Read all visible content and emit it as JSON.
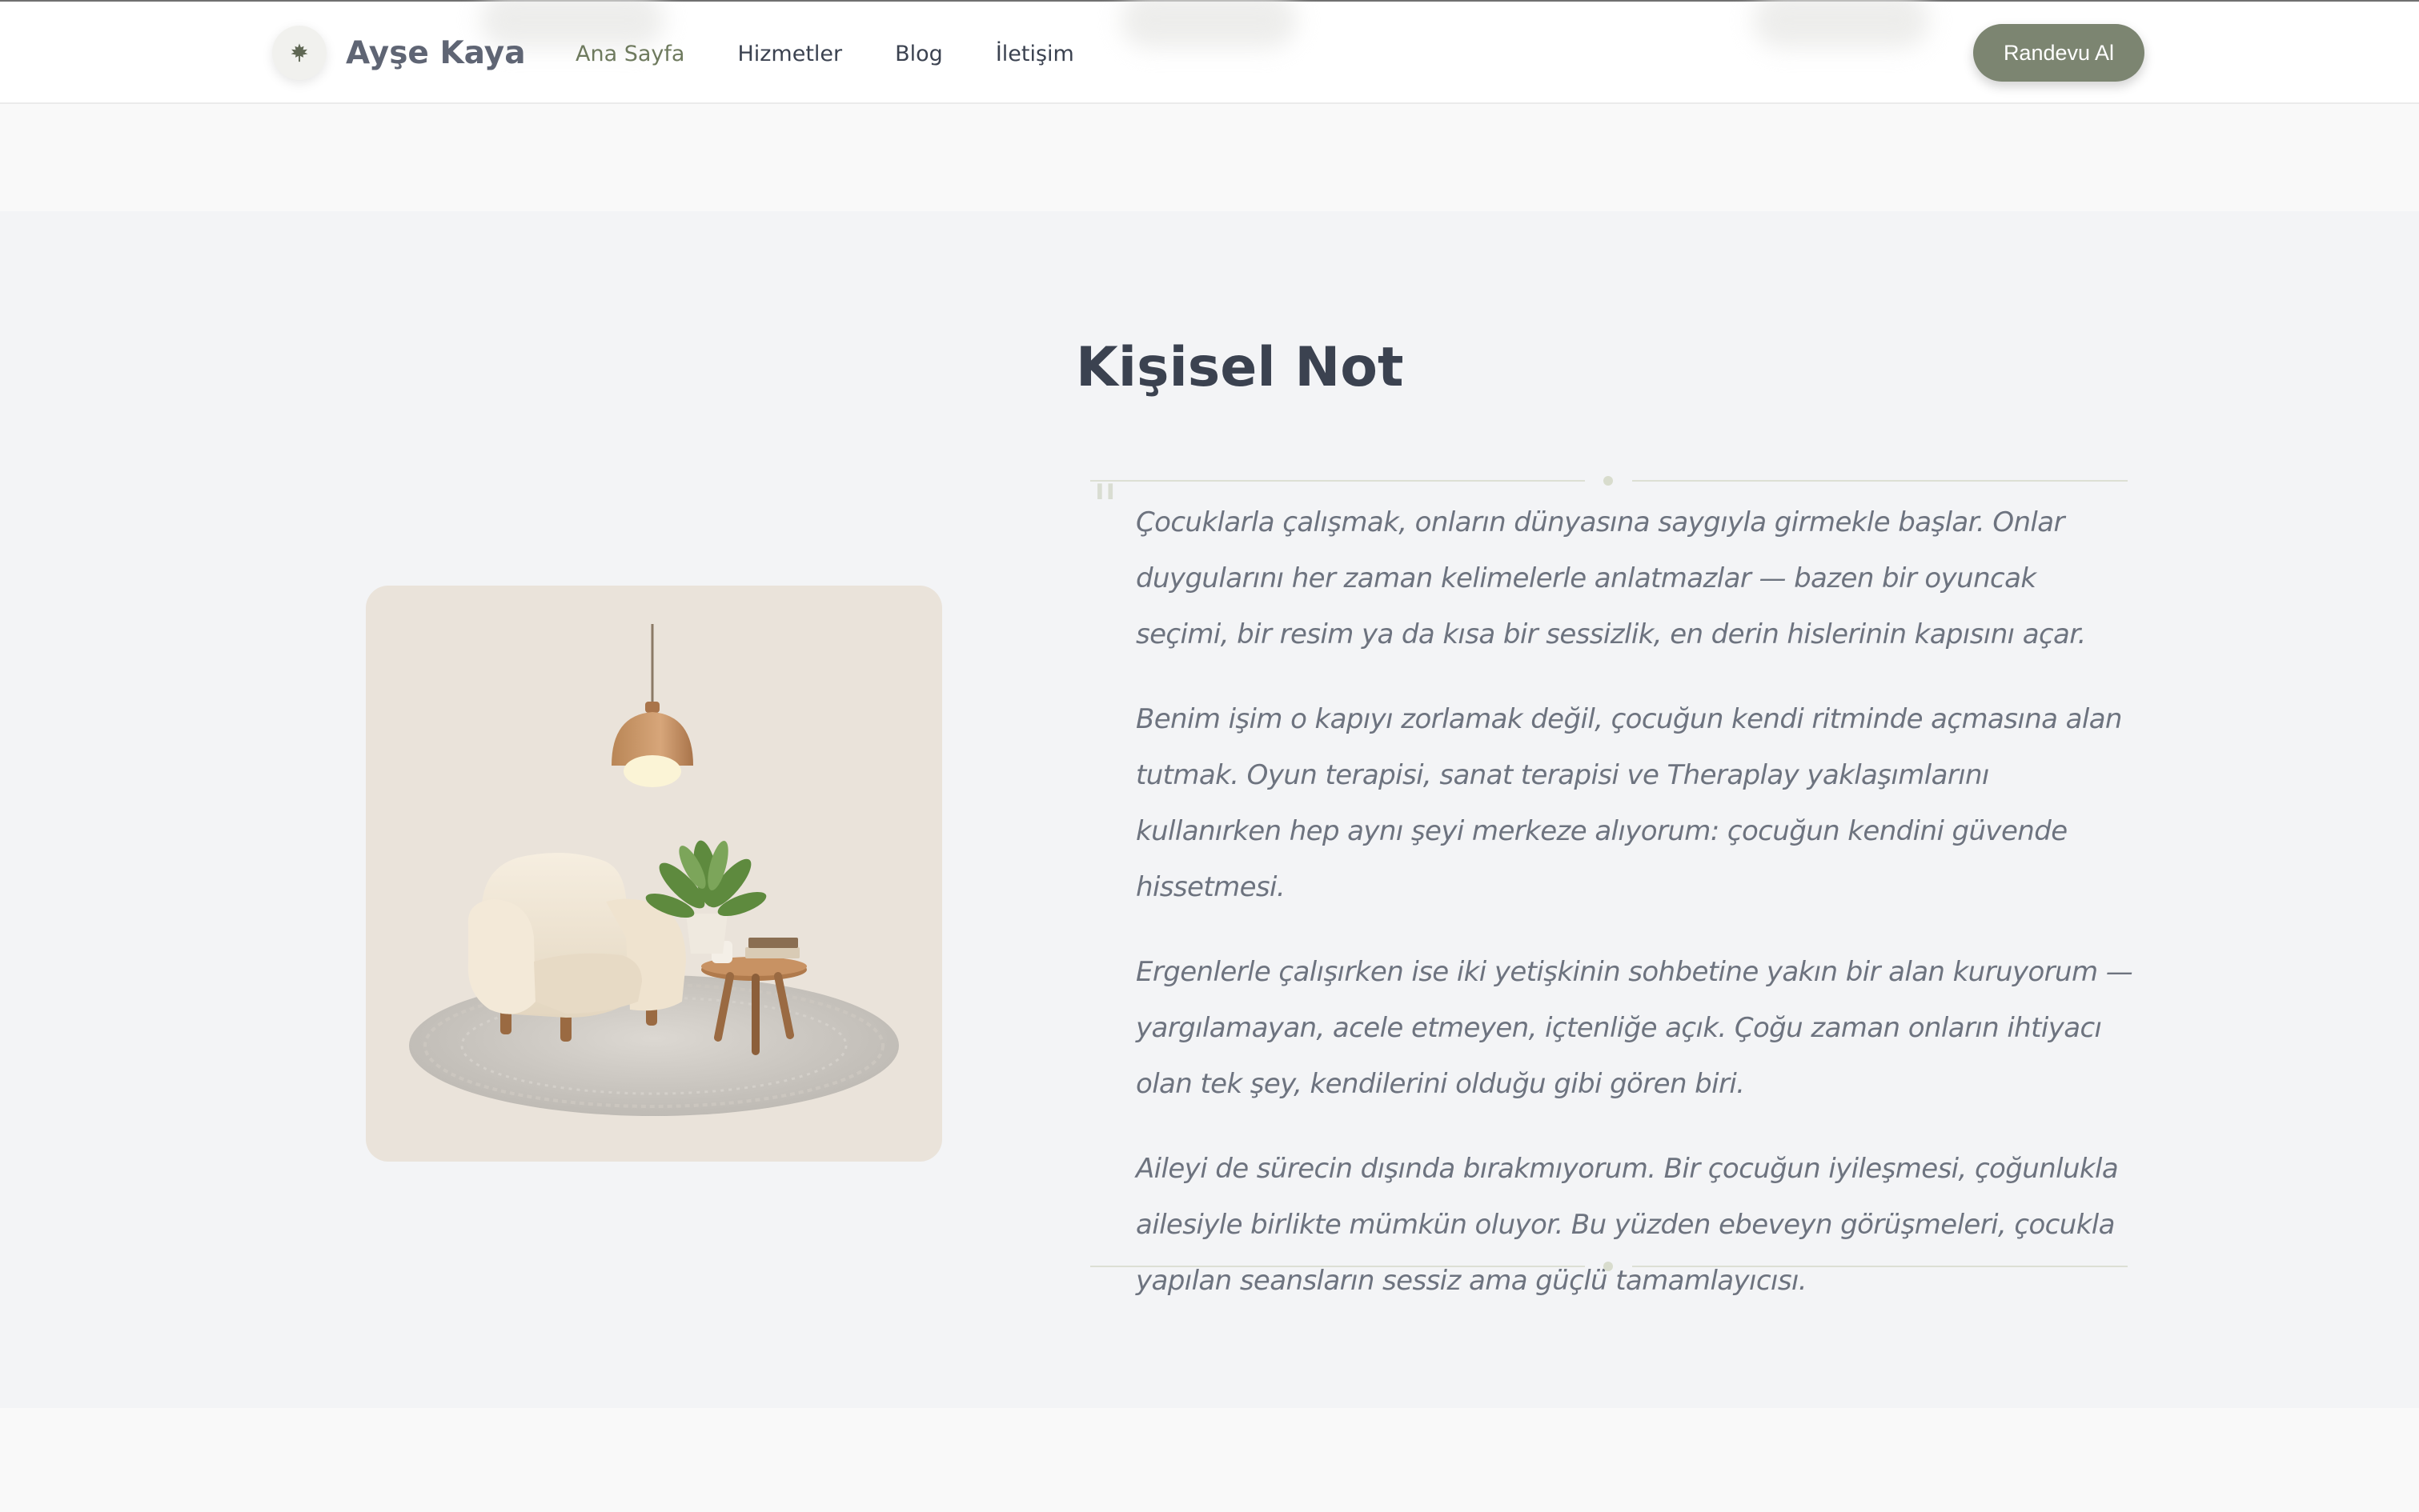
{
  "header": {
    "brand_name": "Ayşe Kaya",
    "nav": [
      {
        "label": "Ana Sayfa",
        "active": true
      },
      {
        "label": "Hizmetler",
        "active": false
      },
      {
        "label": "Blog",
        "active": false
      },
      {
        "label": "İletişim",
        "active": false
      }
    ],
    "cta_label": "Randevu Al",
    "brand_icon": "leaf-icon"
  },
  "section": {
    "title": "Kişisel Not",
    "quote_mark": "\"",
    "paragraphs": [
      "Çocuklarla çalışmak, onların dünyasına saygıyla girmekle başlar. Onlar duygularını her zaman kelimelerle anlatmazlar — bazen bir oyuncak seçimi, bir resim ya da kısa bir sessizlik, en derin hislerinin kapısını açar.",
      "Benim işim o kapıyı zorlamak değil, çocuğun kendi ritminde açmasına alan tutmak. Oyun terapisi, sanat terapisi ve Theraplay yaklaşımlarını kullanırken hep aynı şeyi merkeze alıyorum: çocuğun kendini güvende hissetmesi.",
      "Ergenlerle çalışırken ise iki yetişkinin sohbetine yakın bir alan kuruyorum — yargılamayan, acele etmeyen, içtenliğe açık. Çoğu zaman onların ihtiyacı olan tek şey, kendilerini olduğu gibi gören biri.",
      "Aileyi de sürecin dışında bırakmıyorum. Bir çocuğun iyileşmesi, çoğunlukla ailesiyle birlikte mümkün oluyor. Bu yüzden ebeveyn görüşmeleri, çocukla yapılan seansların sessiz ama güçlü tamamlayıcısı."
    ],
    "image_subject": "armchair-plant-lamp-illustration"
  },
  "colors": {
    "accent": "#7c8571",
    "nav_active": "#6e7a5e",
    "section_bg": "#f3f4f6",
    "card_bg": "#eae3da"
  }
}
